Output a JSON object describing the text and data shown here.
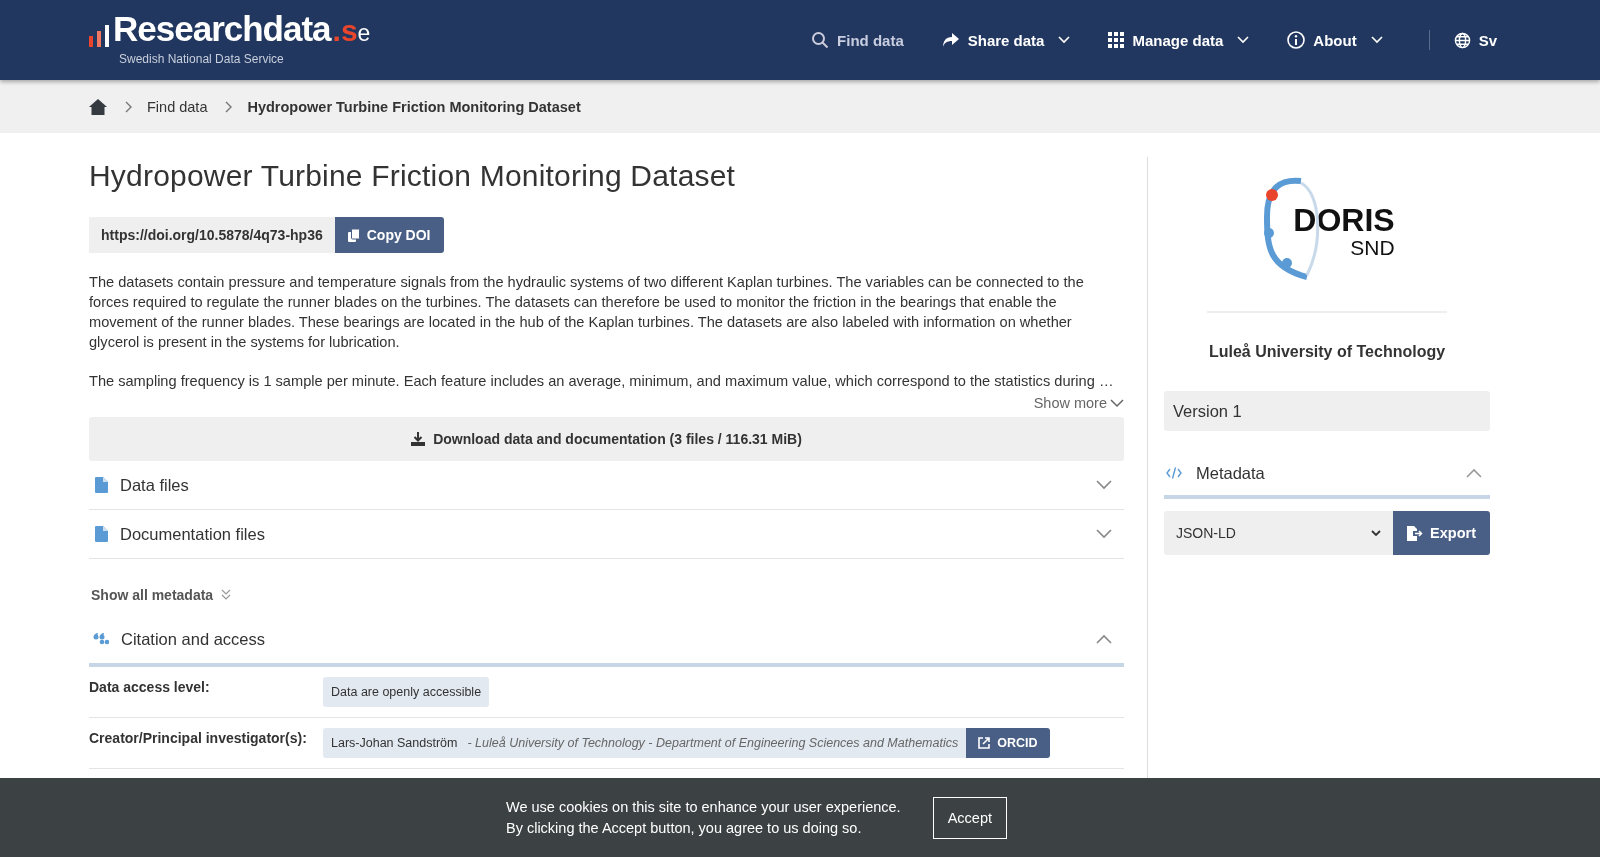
{
  "header": {
    "logo": {
      "name": "Researchdata",
      "tld": ".se",
      "tagline": "Swedish National Data Service"
    },
    "nav": [
      {
        "kind": "search",
        "label": "Find data",
        "dropdown": false
      },
      {
        "kind": "share",
        "label": "Share data",
        "dropdown": true
      },
      {
        "kind": "grid",
        "label": "Manage data",
        "dropdown": true
      },
      {
        "kind": "info",
        "label": "About",
        "dropdown": true
      }
    ],
    "language": "Sv"
  },
  "breadcrumb": [
    {
      "label": "Find data",
      "current": false
    },
    {
      "label": "Hydropower Turbine Friction Monitoring Dataset",
      "current": true
    }
  ],
  "title": "Hydropower Turbine Friction Monitoring Dataset",
  "doi": {
    "value": "https://doi.org/10.5878/4q73-hp36",
    "button": "Copy DOI"
  },
  "description": [
    "The datasets contain pressure and temperature signals from the hydraulic systems of two different Kaplan turbines. The variables can be connected to the forces required to regulate the runner blades on the turbines. The datasets can therefore be used to monitor the friction in the bearings that enable the movement of the runner blades. These bearings are located in the hub of the Kaplan turbines. The datasets are also labeled with information on whether glycerol is present in the systems for lubrication.",
    "The sampling frequency is 1 sample per minute. Each feature includes an average, minimum, and maximum value, which correspond to the statistics during …"
  ],
  "show_more": "Show more",
  "download": "Download data and documentation (3 files / 116.31 MiB)",
  "file_sections": [
    {
      "label": "Data files",
      "expanded": false
    },
    {
      "label": "Documentation files",
      "expanded": false
    }
  ],
  "show_all_metadata": "Show all metadata",
  "citation": {
    "title": "Citation and access",
    "expanded": true,
    "access_label": "Data access level:",
    "access_value": "Data are openly accessible",
    "creators_label": "Creator/Principal investigator(s):",
    "creators": [
      {
        "name": "Lars-Johan Sandström",
        "affiliation": "- Luleå University of Technology - Department of Engineering Sciences and Mathematics",
        "button": "ORCID"
      }
    ]
  },
  "sidebar": {
    "logo": {
      "word": "DORIS",
      "sub": "SND"
    },
    "organisation": "Luleå University of Technology",
    "version": "Version 1",
    "metadata": {
      "title": "Metadata",
      "expanded": true,
      "format": "JSON-LD",
      "button": "Export"
    }
  },
  "cookie": {
    "lines": [
      "We use cookies on this site to enhance your user experience.",
      "By clicking the Accept button, you agree to us doing so."
    ],
    "button": "Accept"
  }
}
